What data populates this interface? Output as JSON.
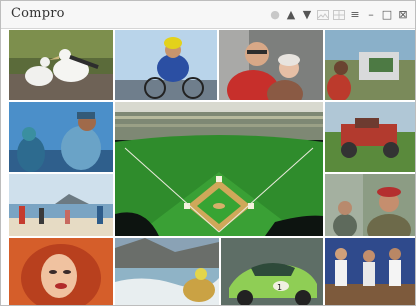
{
  "window": {
    "title": "Compro",
    "controls": [
      {
        "name": "record-icon",
        "glyph": "●"
      },
      {
        "name": "move-up-icon",
        "glyph": "▲"
      },
      {
        "name": "move-down-icon",
        "glyph": "▼"
      },
      {
        "name": "image-view-icon",
        "glyph": ""
      },
      {
        "name": "grid-view-icon",
        "glyph": ""
      },
      {
        "name": "menu-icon",
        "glyph": "≡"
      },
      {
        "name": "minimize-icon",
        "glyph": "–"
      },
      {
        "name": "maximize-icon",
        "glyph": "□"
      },
      {
        "name": "close-icon",
        "glyph": "⊠"
      }
    ]
  },
  "gallery": {
    "tiles": [
      {
        "name": "photo-seabirds",
        "subject": "two white seabirds on rocks"
      },
      {
        "name": "photo-cyclist",
        "subject": "cyclist in yellow helmet"
      },
      {
        "name": "photo-elderly-couple",
        "subject": "elderly man and woman"
      },
      {
        "name": "photo-surveyor",
        "subject": "man with survey equipment"
      },
      {
        "name": "photo-fishermen",
        "subject": "two people by the water"
      },
      {
        "name": "photo-baseball-stadium",
        "subject": "baseball stadium field"
      },
      {
        "name": "photo-farm-machinery",
        "subject": "red farm machinery"
      },
      {
        "name": "photo-beach-walkers",
        "subject": "people walking on a beach"
      },
      {
        "name": "photo-man-in-hat",
        "subject": "man in red hat"
      },
      {
        "name": "photo-woman-portrait",
        "subject": "woman with red hair"
      },
      {
        "name": "photo-rafting",
        "subject": "river rafting"
      },
      {
        "name": "photo-green-car",
        "subject": "green sports car"
      },
      {
        "name": "photo-runners",
        "subject": "runners racing"
      }
    ]
  }
}
